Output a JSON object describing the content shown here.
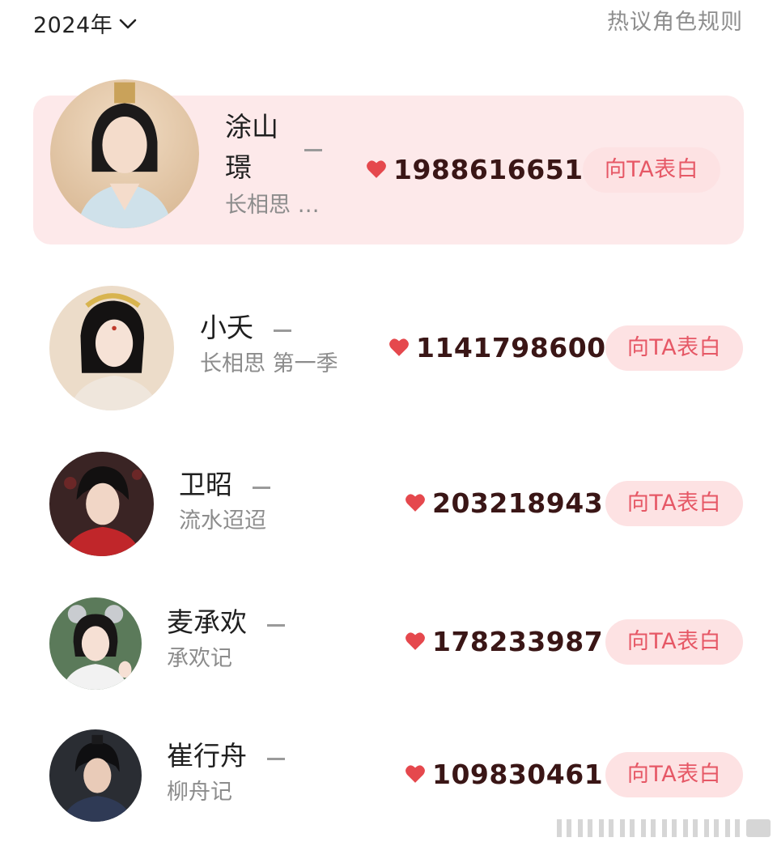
{
  "header": {
    "year_label": "2024年",
    "rules_label": "热议角色规则"
  },
  "accent_color": "#e65866",
  "highlight_color": "#fde9ea",
  "ranking": [
    {
      "name_line1": "涂山",
      "name_line2": "璟",
      "drama": "长相思 …",
      "score": "1988616651",
      "button_label": "向TA表白",
      "rank_change": "—",
      "highlighted": true
    },
    {
      "name": "小夭",
      "drama": "长相思 第一季",
      "score": "1141798600",
      "button_label": "向TA表白",
      "rank_change": "—"
    },
    {
      "name": "卫昭",
      "drama": "流水迢迢",
      "score": "203218943",
      "button_label": "向TA表白",
      "rank_change": "—"
    },
    {
      "name": "麦承欢",
      "drama": "承欢记",
      "score": "178233987",
      "button_label": "向TA表白",
      "rank_change": "—"
    },
    {
      "name": "崔行舟",
      "drama": "柳舟记",
      "score": "109830461",
      "button_label": "向TA表白",
      "rank_change": "—"
    }
  ],
  "icons": {
    "chevron": "chevron-down-icon",
    "heart": "heart-icon"
  }
}
